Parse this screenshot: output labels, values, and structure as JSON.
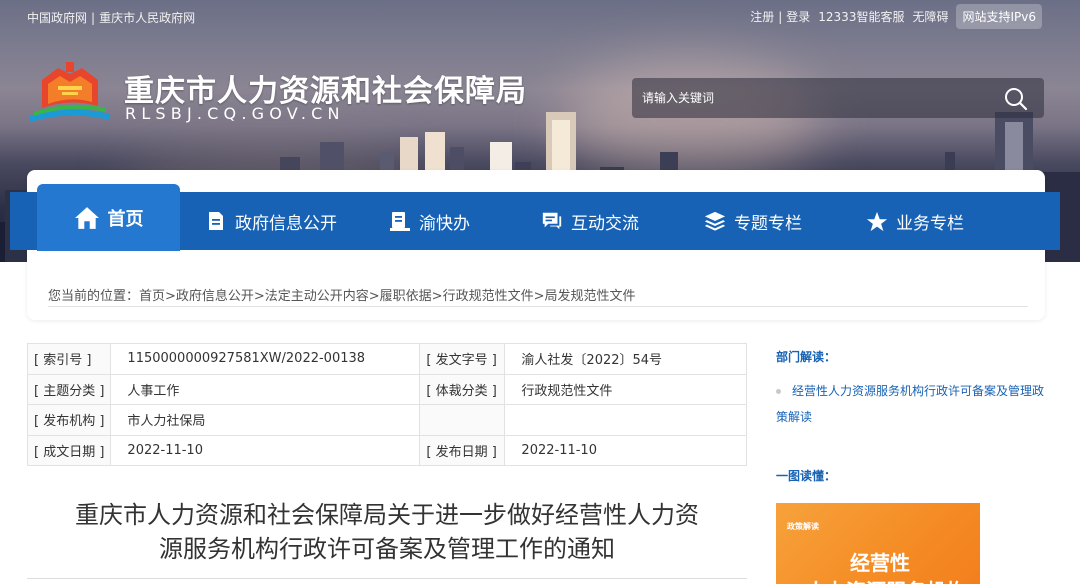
{
  "topbar": {
    "portal_links": [
      "中国政府网",
      "重庆市人民政府网"
    ],
    "auth_links": [
      "注册",
      "登录"
    ],
    "tools": [
      "12333智能客服",
      "无障碍"
    ],
    "ipv6": "网站支持IPv6"
  },
  "site": {
    "title": "重庆市人力资源和社会保障局",
    "domain": "RLSBJ.CQ.GOV.CN"
  },
  "search": {
    "placeholder": "请输入关键词",
    "icon": "search-icon"
  },
  "nav": {
    "active": {
      "label": "首页",
      "icon": "home-icon"
    },
    "items": [
      {
        "label": "政府信息公开",
        "icon": "document-icon"
      },
      {
        "label": "渝快办",
        "icon": "service-icon"
      },
      {
        "label": "互动交流",
        "icon": "chat-icon"
      },
      {
        "label": "专题专栏",
        "icon": "layers-icon"
      },
      {
        "label": "业务专栏",
        "icon": "star-icon"
      }
    ]
  },
  "breadcrumb": "您当前的位置：首页>政府信息公开>法定主动公开内容>履职依据>行政规范性文件>局发规范性文件",
  "meta": {
    "index_label": "[ 索引号 ]",
    "index_value": "1150000000927581XW/2022-00138",
    "doc_no_label": "[ 发文字号 ]",
    "doc_no_value": "渝人社发〔2022〕54号",
    "topic_label": "[ 主题分类 ]",
    "topic_value": "人事工作",
    "genre_label": "[ 体裁分类 ]",
    "genre_value": "行政规范性文件",
    "issuer_label": "[ 发布机构 ]",
    "issuer_value": "市人力社保局",
    "written_label": "[ 成文日期 ]",
    "written_value": "2022-11-10",
    "publish_label": "[ 发布日期 ]",
    "publish_value": "2022-11-10"
  },
  "article": {
    "title_line1": "重庆市人力资源和社会保障局关于进一步做好经营性人力资",
    "title_line2": "源服务机构行政许可备案及管理工作的通知"
  },
  "sidebar": {
    "interpret_title": "部门解读：",
    "interpret_link": "经营性人力资源服务机构行政许可备案及管理政策解读",
    "visual_title": "一图读懂：",
    "poster_tag": "政策解读",
    "poster_line1": "经营性",
    "poster_line2": "人力资源服务机构"
  },
  "colors": {
    "nav_blue": "#1762b4",
    "nav_active": "#2478cf",
    "poster_orange": "#f58c24"
  }
}
